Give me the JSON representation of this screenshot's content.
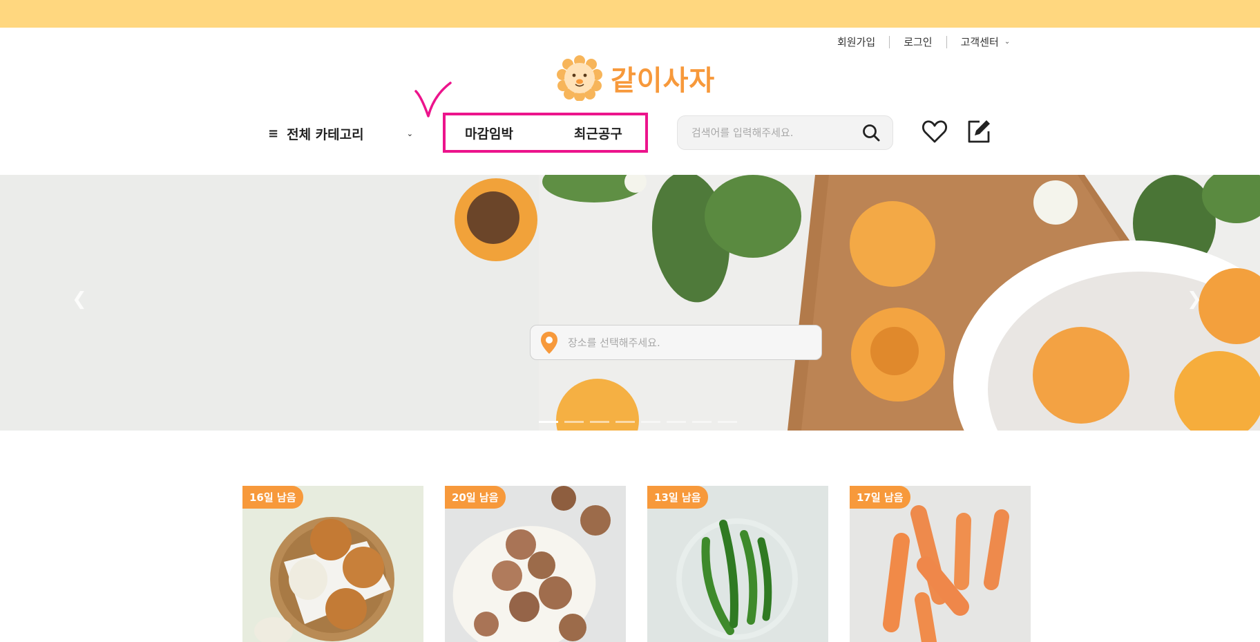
{
  "header": {
    "util_links": [
      "회원가입",
      "로그인",
      "고객센터"
    ],
    "logo_text": "같이사자",
    "category_label": "전체 카테고리",
    "quick_nav": [
      "마감임박",
      "최근공구"
    ],
    "search_placeholder": "검색어를 입력해주세요."
  },
  "hero": {
    "location_placeholder": "장소를 선택해주세요.",
    "slide_count": 8,
    "active_slide": 1
  },
  "products": [
    {
      "badge": "16일 남음",
      "image": "onions"
    },
    {
      "badge": "20일 남음",
      "image": "shiitake-mushrooms"
    },
    {
      "badge": "13일 남음",
      "image": "green-chili-peppers"
    },
    {
      "badge": "17일 남음",
      "image": "carrots"
    }
  ],
  "colors": {
    "top_strip": "#ffd77f",
    "accent": "#f7993b",
    "highlight_box": "#ec148c"
  }
}
